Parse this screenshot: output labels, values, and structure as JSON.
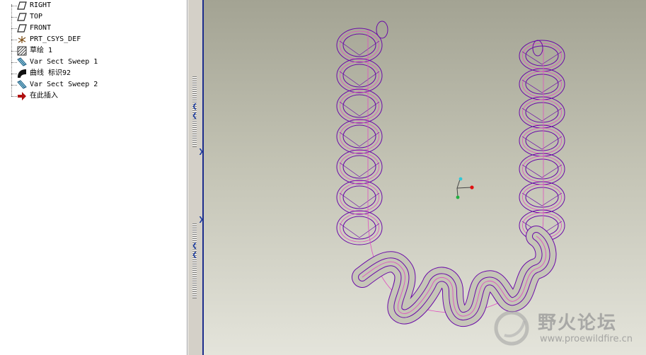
{
  "model_tree": {
    "items": [
      {
        "label": "RIGHT",
        "icon": "datum-plane-icon"
      },
      {
        "label": "TOP",
        "icon": "datum-plane-icon"
      },
      {
        "label": "FRONT",
        "icon": "datum-plane-icon"
      },
      {
        "label": "PRT_CSYS_DEF",
        "icon": "coordinate-system-icon"
      },
      {
        "label": "草绘 1",
        "icon": "sketch-icon"
      },
      {
        "label": "Var Sect Sweep 1",
        "icon": "var-sect-sweep-icon"
      },
      {
        "label": "曲线 标识92",
        "icon": "curve-icon"
      },
      {
        "label": "Var Sect Sweep 2",
        "icon": "var-sect-sweep-icon"
      },
      {
        "label": "在此插入",
        "icon": "insert-here-arrow-icon"
      }
    ]
  },
  "watermark": {
    "title": "野火论坛",
    "url": "www.proewildfire.cn"
  },
  "colors": {
    "spring_outline": "#6a0aa8",
    "spring_center": "#e050c0",
    "background_top": "#a3a393",
    "background_bottom": "#e4e4db"
  }
}
